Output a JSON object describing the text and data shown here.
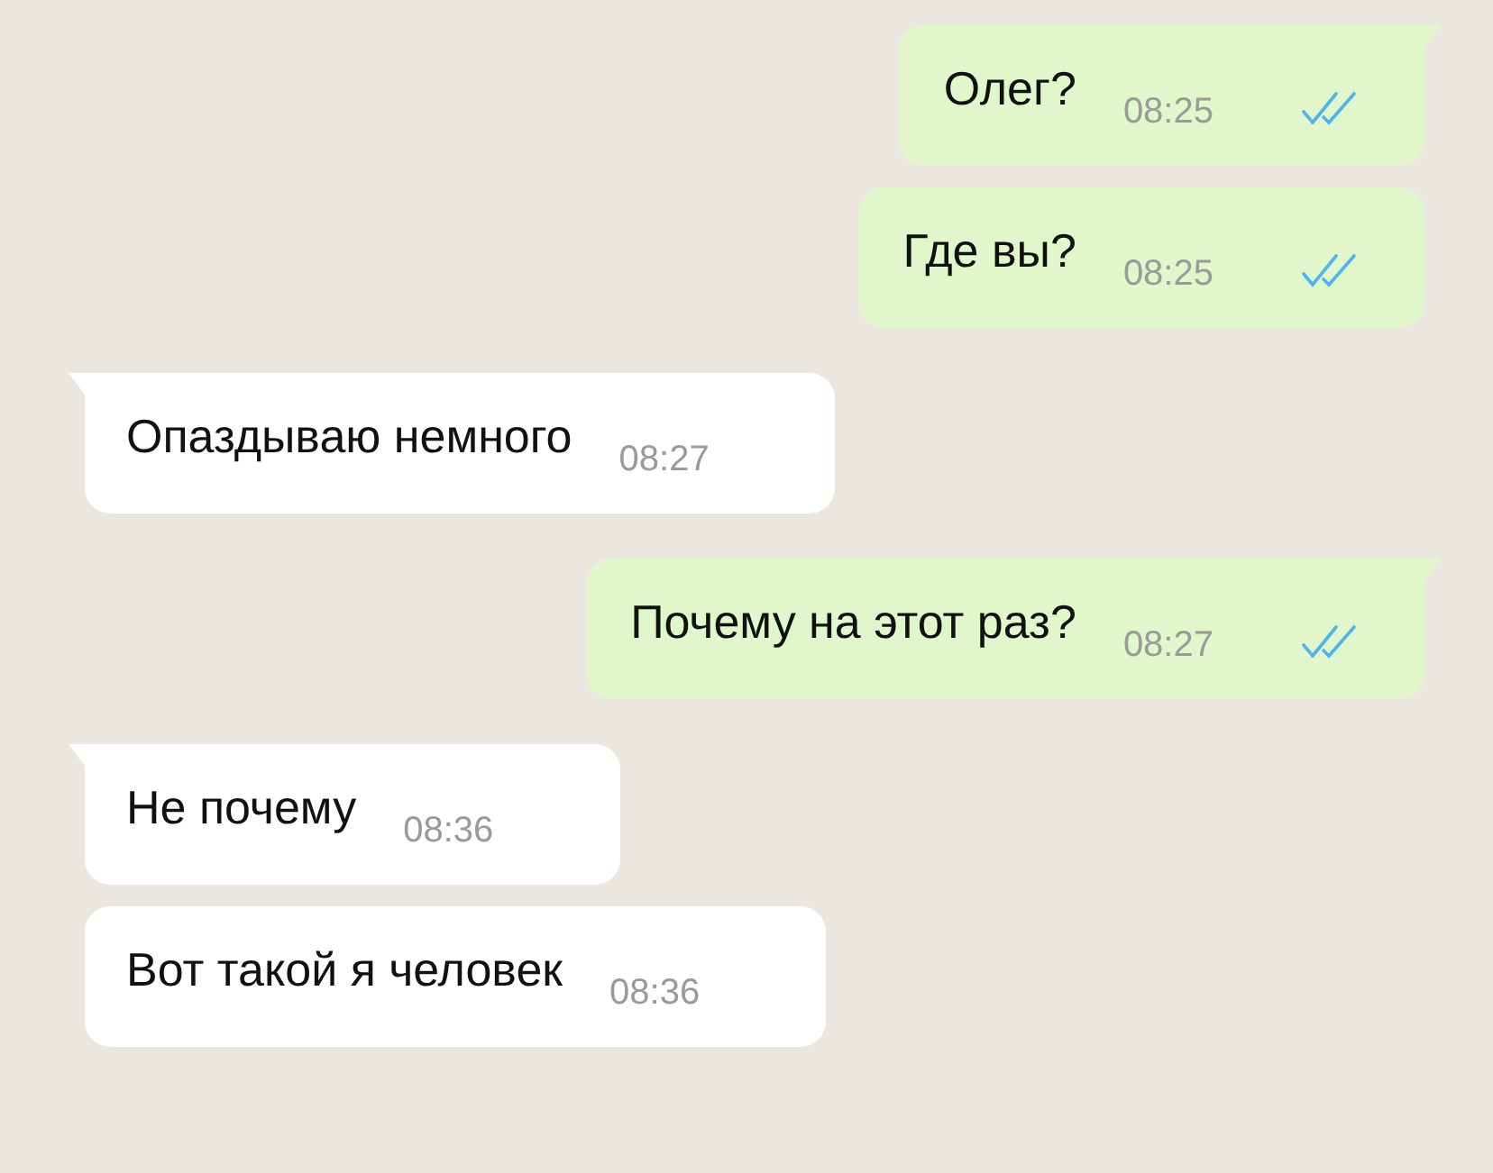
{
  "messages": [
    {
      "kind": "out",
      "text": "Олег?",
      "time": "08:25",
      "read": true,
      "tail": true
    },
    {
      "kind": "out",
      "text": "Где вы?",
      "time": "08:25",
      "read": true,
      "tail": false
    },
    {
      "kind": "in",
      "text": "Опаздываю немного",
      "time": "08:27",
      "tail": true
    },
    {
      "kind": "out",
      "text": "Почему на этот раз?",
      "time": "08:27",
      "read": true,
      "tail": true
    },
    {
      "kind": "in",
      "text": "Не почему",
      "time": "08:36",
      "tail": true
    },
    {
      "kind": "in",
      "text": "Вот такой я человек",
      "time": "08:36",
      "tail": false
    }
  ]
}
